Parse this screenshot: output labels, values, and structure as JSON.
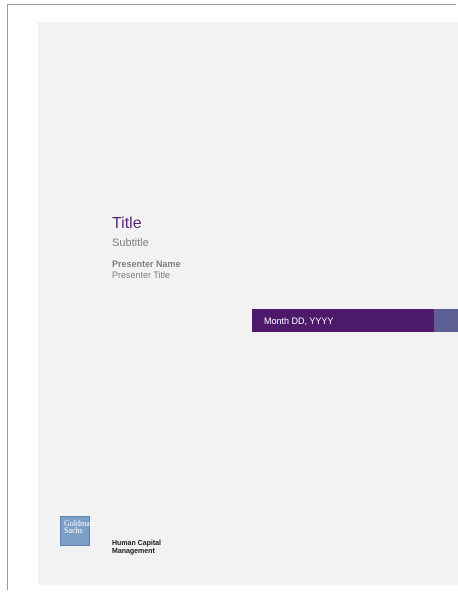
{
  "slide": {
    "title": "Title",
    "subtitle": "Subtitle",
    "presenter_name": "Presenter Name",
    "presenter_title": "Presenter Title",
    "date": "Month DD, YYYY"
  },
  "logo": {
    "line1": "Goldman",
    "line2": "Sachs"
  },
  "division": {
    "line1": "Human Capital",
    "line2": "Management"
  },
  "colors": {
    "title": "#5b1f78",
    "date_bar": "#4d1a6b",
    "date_accent": "#5b5f94",
    "logo_box": "#7ba0c8",
    "slide_background": "#f2f2f2"
  }
}
